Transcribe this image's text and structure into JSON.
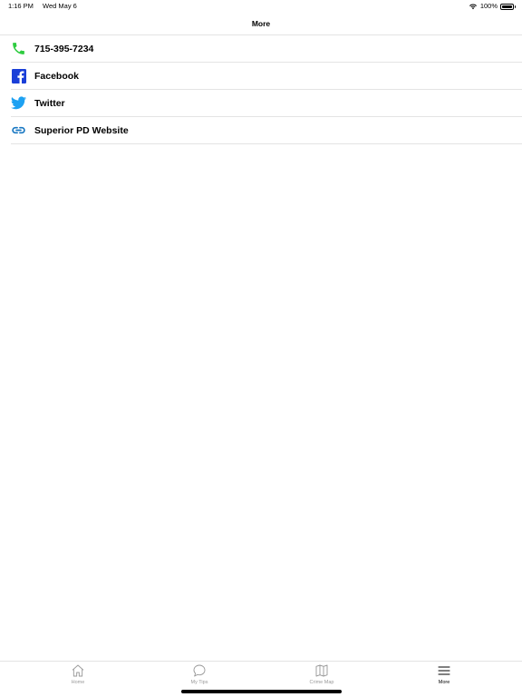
{
  "status_bar": {
    "time": "1:16 PM",
    "date": "Wed May 6",
    "battery": "100%"
  },
  "nav": {
    "title": "More"
  },
  "list": {
    "items": [
      {
        "label": "715-395-7234",
        "icon": "phone-icon",
        "color": "#2ecc40"
      },
      {
        "label": "Facebook",
        "icon": "facebook-icon",
        "color": "#1a3fd8"
      },
      {
        "label": "Twitter",
        "icon": "twitter-icon",
        "color": "#1da1f2"
      },
      {
        "label": "Superior PD Website",
        "icon": "link-icon",
        "color": "#1877c2"
      }
    ]
  },
  "tabs": [
    {
      "label": "Home",
      "icon": "home-icon",
      "active": false
    },
    {
      "label": "My Tips",
      "icon": "chat-bubble-icon",
      "active": false
    },
    {
      "label": "Crime Map",
      "icon": "map-icon",
      "active": false
    },
    {
      "label": "More",
      "icon": "menu-icon",
      "active": true
    }
  ]
}
